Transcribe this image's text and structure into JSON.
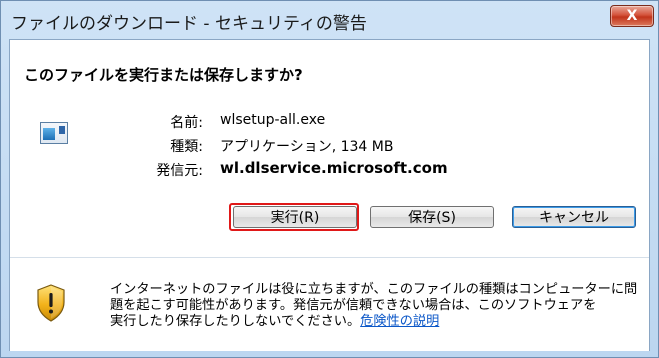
{
  "window": {
    "title": "ファイルのダウンロード - セキュリティの警告",
    "close_glyph": "X"
  },
  "prompt": {
    "question": "このファイルを実行または保存しますか?"
  },
  "file_info": {
    "name_label": "名前:",
    "name_value": "wlsetup-all.exe",
    "type_label": "種類:",
    "type_value": "アプリケーション, 134 MB",
    "source_label": "発信元:",
    "source_value": "wl.dlservice.microsoft.com",
    "icon": "application-icon"
  },
  "buttons": {
    "run_label": "実行(R)",
    "save_label": "保存(S)",
    "cancel_label": "キャンセル"
  },
  "warning": {
    "icon": "shield-warning-icon",
    "line1": "インターネットのファイルは役に立ちますが、このファイルの種類はコンピューターに問",
    "line2": "題を起こす可能性があります。発信元が信頼できない場合は、このソフトウェアを",
    "line3_prefix": "実行したり保存したりしないでください。",
    "link_text": "危険性の説明"
  },
  "colors": {
    "highlight_box": "#e01818",
    "link": "#0b57c8",
    "close_button": "#c2341b",
    "titlebar": "#cfe3f6"
  }
}
